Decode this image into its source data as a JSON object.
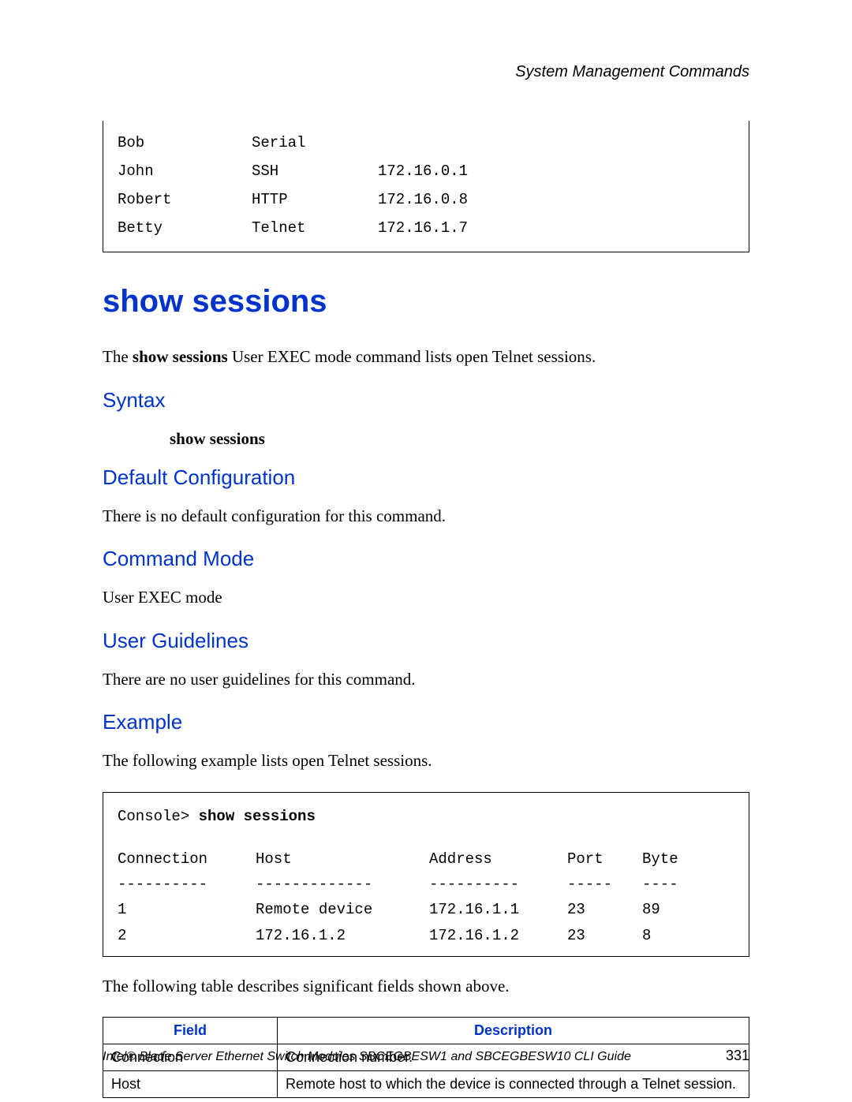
{
  "header": {
    "right": "System Management Commands"
  },
  "users_table": {
    "rows": [
      {
        "name": "Bob",
        "proto": "Serial",
        "addr": ""
      },
      {
        "name": "John",
        "proto": "SSH",
        "addr": "172.16.0.1"
      },
      {
        "name": "Robert",
        "proto": "HTTP",
        "addr": "172.16.0.8"
      },
      {
        "name": "Betty",
        "proto": "Telnet",
        "addr": "172.16.1.7"
      }
    ]
  },
  "title": "show sessions",
  "intro_pre": "The ",
  "intro_bold": "show sessions",
  "intro_post": " User EXEC mode command lists open Telnet sessions.",
  "syntax": {
    "heading": "Syntax",
    "text": "show sessions"
  },
  "default_cfg": {
    "heading": "Default Configuration",
    "text": "There is no default configuration for this command."
  },
  "cmd_mode": {
    "heading": "Command Mode",
    "text": "User EXEC mode"
  },
  "guidelines": {
    "heading": "User Guidelines",
    "text": "There are no user guidelines for this command."
  },
  "example": {
    "heading": "Example",
    "intro": "The following example lists open Telnet sessions.",
    "prompt": "Console> ",
    "cmd": "show sessions",
    "cols": {
      "h1": "Connection",
      "h2": "Host",
      "h3": "Address",
      "h4": "Port",
      "h5": "Byte"
    },
    "dashes": {
      "d1": "----------",
      "d2": "-------------",
      "d3": "----------",
      "d4": "-----",
      "d5": "----"
    },
    "rows": [
      {
        "c1": "1",
        "c2": "Remote device",
        "c3": "172.16.1.1",
        "c4": "23",
        "c5": "89"
      },
      {
        "c1": "2",
        "c2": "172.16.1.2",
        "c3": "172.16.1.2",
        "c4": "23",
        "c5": "8"
      }
    ],
    "after": "The following table describes significant fields shown above."
  },
  "desc_table": {
    "head": {
      "field": "Field",
      "desc": "Description"
    },
    "rows": [
      {
        "field": "Connection",
        "desc": "Connection number."
      },
      {
        "field": "Host",
        "desc": "Remote host to which the device is connected through a Telnet session."
      }
    ]
  },
  "footer": {
    "text": "Intel® Blade Server Ethernet Switch Modules SBCEGBESW1 and SBCEGBESW10 CLI Guide",
    "page": "331"
  }
}
